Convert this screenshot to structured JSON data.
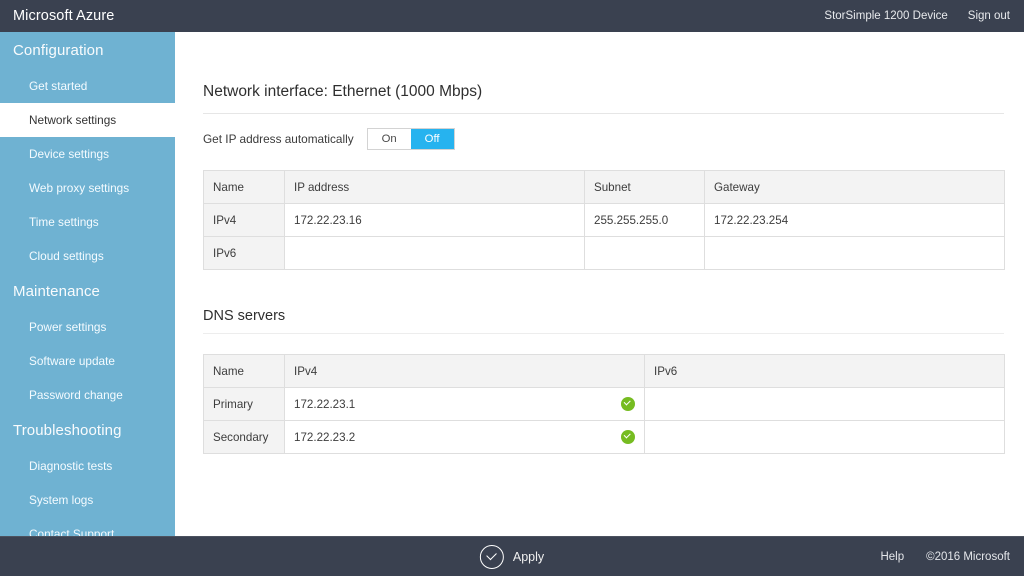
{
  "header": {
    "brand": "Microsoft Azure",
    "device_name": "StorSimple 1200 Device",
    "signout_label": "Sign out"
  },
  "sidebar": {
    "groups": [
      {
        "title": "Configuration",
        "items": [
          {
            "label": "Get started",
            "selected": false
          },
          {
            "label": "Network settings",
            "selected": true
          },
          {
            "label": "Device settings",
            "selected": false
          },
          {
            "label": "Web proxy settings",
            "selected": false
          },
          {
            "label": "Time settings",
            "selected": false
          },
          {
            "label": "Cloud settings",
            "selected": false
          }
        ]
      },
      {
        "title": "Maintenance",
        "items": [
          {
            "label": "Power settings",
            "selected": false
          },
          {
            "label": "Software update",
            "selected": false
          },
          {
            "label": "Password change",
            "selected": false
          }
        ]
      },
      {
        "title": "Troubleshooting",
        "items": [
          {
            "label": "Diagnostic tests",
            "selected": false
          },
          {
            "label": "System logs",
            "selected": false
          },
          {
            "label": "Contact Support",
            "selected": false
          }
        ]
      }
    ]
  },
  "main": {
    "page_title": "Network interface: Ethernet (1000 Mbps)",
    "auto_ip": {
      "label": "Get IP address automatically",
      "on_label": "On",
      "off_label": "Off",
      "selected": "Off"
    },
    "ip_table": {
      "columns": [
        "Name",
        "IP address",
        "Subnet",
        "Gateway"
      ],
      "rows": [
        {
          "name": "IPv4",
          "ip_address": "172.22.23.16",
          "subnet": "255.255.255.0",
          "gateway": "172.22.23.254",
          "ip_valid": false
        },
        {
          "name": "IPv6",
          "ip_address": "",
          "subnet": "",
          "gateway": "",
          "ip_valid": false
        }
      ]
    },
    "dns_heading": "DNS servers",
    "dns_table": {
      "columns": [
        "Name",
        "IPv4",
        "IPv6"
      ],
      "rows": [
        {
          "name": "Primary",
          "ipv4": "172.22.23.1",
          "ipv6": "",
          "ipv4_valid": true
        },
        {
          "name": "Secondary",
          "ipv4": "172.22.23.2",
          "ipv6": "",
          "ipv4_valid": true
        }
      ]
    }
  },
  "footer": {
    "apply_label": "Apply",
    "help_label": "Help",
    "copyright": "©2016 Microsoft"
  },
  "colors": {
    "header_bg": "#3a4150",
    "sidebar_bg": "#6fb2d2",
    "accent": "#26b3ef",
    "valid_green": "#76bc21",
    "table_header_bg": "#f3f3f3",
    "border": "#dedede"
  }
}
